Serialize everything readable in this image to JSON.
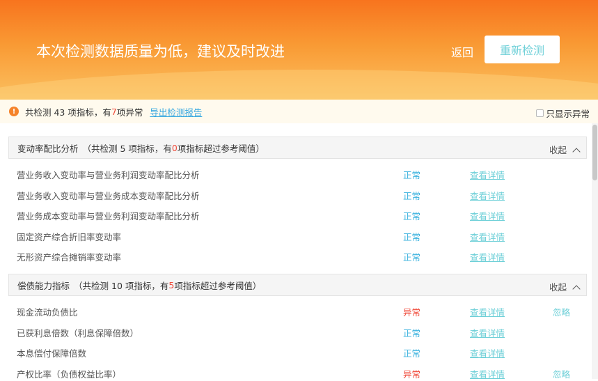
{
  "header": {
    "title": "本次检测数据质量为低，建议及时改进",
    "back": "返回",
    "recheck": "重新检测"
  },
  "notice": {
    "prefix": "共检测 43 项指标，有 ",
    "count": "7",
    "suffix": " 项异常",
    "export": "导出检测报告",
    "only_abnormal": "只显示异常"
  },
  "colors": {
    "abnormal": "#f04a3a",
    "normal": "#3ab2de",
    "link": "#6fd0d8",
    "header": "#f8741e"
  },
  "sections": [
    {
      "name": "变动率配比分析",
      "pre": "（共检测 5 项指标，有 ",
      "count": "0",
      "post": " 项指标超过参考阈值）",
      "fold": "收起",
      "rows": [
        {
          "name": "营业务收入变动率与营业务利润变动率配比分析",
          "status": "正常",
          "detail": "查看详情"
        },
        {
          "name": "营业务收入变动率与营业务成本变动率配比分析",
          "status": "正常",
          "detail": "查看详情"
        },
        {
          "name": "营业务成本变动率与营业务利润变动率配比分析",
          "status": "正常",
          "detail": "查看详情"
        },
        {
          "name": "固定资产综合折旧率变动率",
          "status": "正常",
          "detail": "查看详情"
        },
        {
          "name": "无形资产综合摊销率变动率",
          "status": "正常",
          "detail": "查看详情"
        }
      ]
    },
    {
      "name": "偿债能力指标",
      "pre": "（共检测 10 项指标，有 ",
      "count": "5",
      "post": " 项指标超过参考阈值）",
      "fold": "收起",
      "rows": [
        {
          "name": "现金流动负债比",
          "status": "异常",
          "detail": "查看详情",
          "ignore": "忽略"
        },
        {
          "name": "已获利息倍数（利息保障倍数）",
          "status": "正常",
          "detail": "查看详情"
        },
        {
          "name": "本息偿付保障倍数",
          "status": "正常",
          "detail": "查看详情"
        },
        {
          "name": "产权比率（负债权益比率）",
          "status": "异常",
          "detail": "查看详情",
          "ignore": "忽略"
        }
      ]
    }
  ]
}
